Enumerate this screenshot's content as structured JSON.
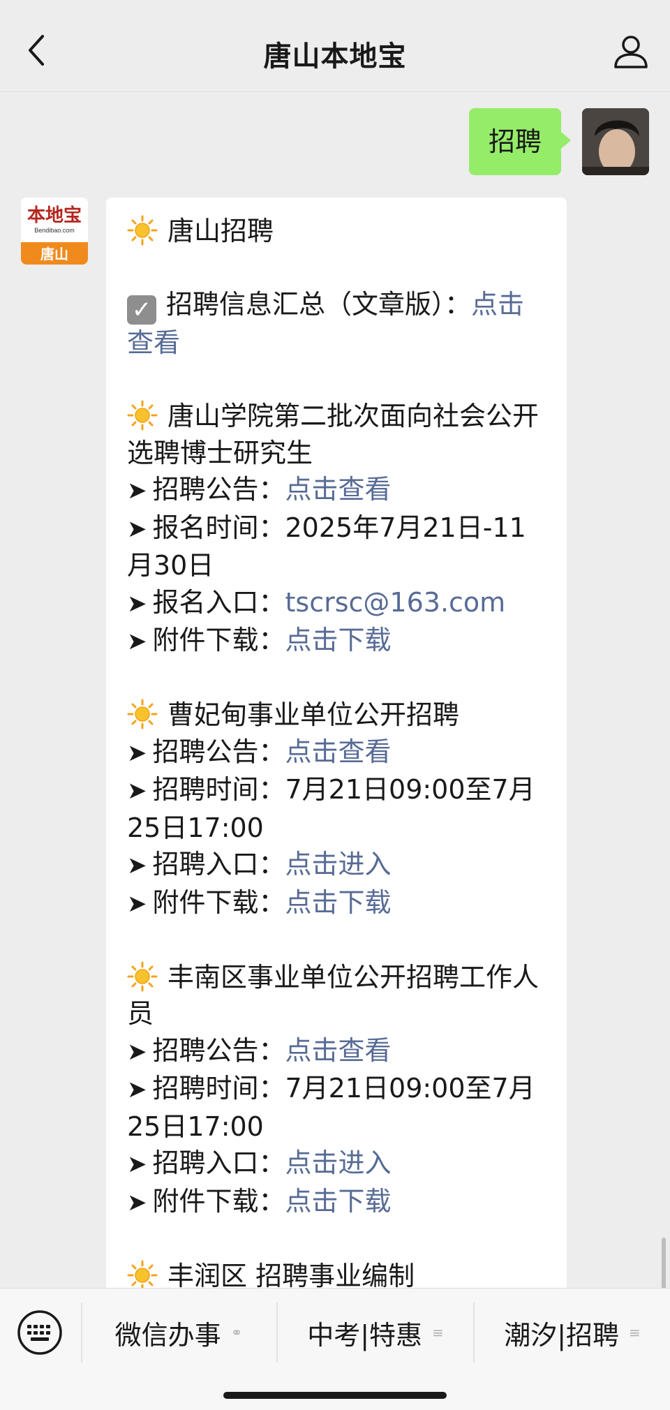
{
  "header": {
    "title": "唐山本地宝",
    "back_icon": "chevron-left-icon",
    "profile_icon": "person-icon"
  },
  "chat": {
    "sent_message": "招聘",
    "bot_logo": {
      "top_text": "本地宝",
      "sub_text": "Bendibao.com",
      "bottom_text": "唐山"
    },
    "received": [
      {
        "type": "heading",
        "text": "唐山招聘"
      },
      {
        "type": "blank"
      },
      {
        "type": "check",
        "text": "招聘信息汇总（文章版）：",
        "link": "点击查看"
      },
      {
        "type": "blank"
      },
      {
        "type": "heading",
        "text": "唐山学院第二批次面向社会公开选聘博士研究生"
      },
      {
        "type": "item",
        "label": "招聘公告：",
        "link": "点击查看"
      },
      {
        "type": "item",
        "label": "报名时间：2025年7月21日-11月30日"
      },
      {
        "type": "item",
        "label": "报名入口：",
        "link": "tscrsc@163.com"
      },
      {
        "type": "item",
        "label": "附件下载：",
        "link": "点击下载"
      },
      {
        "type": "blank"
      },
      {
        "type": "heading",
        "text": "曹妃甸事业单位公开招聘"
      },
      {
        "type": "item",
        "label": "招聘公告：",
        "link": "点击查看"
      },
      {
        "type": "item",
        "label": "招聘时间：7月21日09:00至7月25日17:00"
      },
      {
        "type": "item",
        "label": "招聘入口：",
        "link": "点击进入"
      },
      {
        "type": "item",
        "label": "附件下载：",
        "link": "点击下载"
      },
      {
        "type": "blank"
      },
      {
        "type": "heading",
        "text": "丰南区事业单位公开招聘工作人员"
      },
      {
        "type": "item",
        "label": "招聘公告：",
        "link": "点击查看"
      },
      {
        "type": "item",
        "label": "招聘时间：7月21日09:00至7月25日17:00"
      },
      {
        "type": "item",
        "label": "招聘入口：",
        "link": "点击进入"
      },
      {
        "type": "item",
        "label": "附件下载：",
        "link": "点击下载"
      },
      {
        "type": "blank"
      },
      {
        "type": "heading",
        "text": "丰润区 招聘事业编制"
      }
    ],
    "link_color": "#576b95",
    "sent_bubble_color": "#95ec69"
  },
  "bottom_menu": {
    "keyboard_icon": "keyboard-icon",
    "items": [
      {
        "label": "微信办事",
        "icon": "link-icon",
        "glyph": "⚭"
      },
      {
        "label": "中考|特惠",
        "icon": "menu-lines-icon",
        "glyph": "≡"
      },
      {
        "label": "潮汐|招聘",
        "icon": "menu-lines-icon",
        "glyph": "≡"
      }
    ]
  }
}
